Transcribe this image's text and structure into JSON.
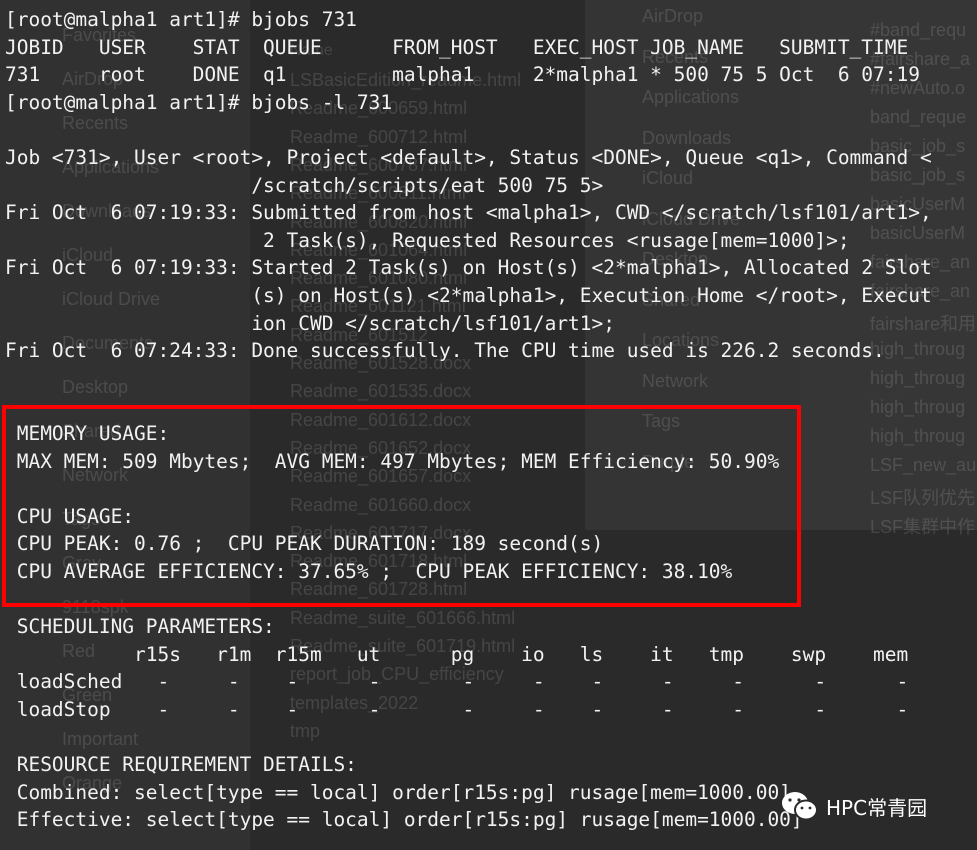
{
  "background_window": {
    "sidebar": [
      "Favorites",
      "AirDrop",
      "Recents",
      "Applications",
      "Downloads",
      "iCloud",
      "iCloud Drive",
      "Documents",
      "Desktop",
      "Shared",
      "Network",
      "Tags",
      "Gray",
      "9118spk",
      "Red",
      "Green",
      "Important",
      "Orange"
    ],
    "column_header": "Name",
    "files": [
      "LSBasicEdition_readme.html",
      "Readme_600659.html",
      "Readme_600712.html",
      "Readme_600787.html",
      "Readme_600811.html",
      "Readme_600820.html",
      "Readme_601064.html",
      "Readme_601080.html",
      "Readme_601121.html",
      "Readme_601512",
      "Readme_601528.docx",
      "Readme_601535.docx",
      "Readme_601612.docx",
      "Readme_601652.docx",
      "Readme_601657.docx",
      "Readme_601660.docx",
      "Readme_601717.docx",
      "Readme_601718.html",
      "Readme_601728.html",
      "Readme_suite_601666.html",
      "Readme_suite_601719.html",
      "report_job_CPU_efficiency",
      "templates_2022",
      "tmp"
    ],
    "popup": [
      "AirDrop",
      "Recents",
      "Applications",
      "Downloads",
      "iCloud",
      "iCloud Drive",
      "Desktop",
      "Shared",
      "Locations",
      "Network",
      "Tags",
      "Purple"
    ],
    "right_files": [
      "#band_requ",
      "#fairshare_a",
      "#newAuto.o",
      "band_reque",
      "basic_job_s",
      "basic_job_s",
      "basicUserM",
      "basicUserM",
      "fairshare_an",
      "fairshare_an",
      "fairshare和用",
      "high_throug",
      "high_throug",
      "high_throug",
      "high_throug",
      "LSF_new_au",
      "LSF队列优先",
      "LSF集群中作"
    ]
  },
  "terminal": {
    "lines": [
      "[root@malpha1 art1]# bjobs 731",
      "JOBID   USER    STAT  QUEUE      FROM_HOST   EXEC_HOST JOB_NAME   SUBMIT_TIME",
      "731     root    DONE  q1         malpha1     2*malpha1 * 500 75 5 Oct  6 07:19",
      "[root@malpha1 art1]# bjobs -l 731",
      "",
      "Job <731>, User <root>, Project <default>, Status <DONE>, Queue <q1>, Command <",
      "                     /scratch/scripts/eat 500 75 5>",
      "Fri Oct  6 07:19:33: Submitted from host <malpha1>, CWD </scratch/lsf101/art1>,",
      "                      2 Task(s), Requested Resources <rusage[mem=1000]>;",
      "Fri Oct  6 07:19:33: Started 2 Task(s) on Host(s) <2*malpha1>, Allocated 2 Slot",
      "                     (s) on Host(s) <2*malpha1>, Execution Home </root>, Execut",
      "                     ion CWD </scratch/lsf101/art1>;",
      "Fri Oct  6 07:24:33: Done successfully. The CPU time used is 226.2 seconds.",
      "",
      "",
      " MEMORY USAGE:",
      " MAX MEM: 509 Mbytes;  AVG MEM: 497 Mbytes; MEM Efficiency: 50.90%",
      "",
      " CPU USAGE:",
      " CPU PEAK: 0.76 ;  CPU PEAK DURATION: 189 second(s)",
      " CPU AVERAGE EFFICIENCY: 37.65% ;  CPU PEAK EFFICIENCY: 38.10%",
      "",
      " SCHEDULING PARAMETERS:",
      "           r15s   r1m  r15m   ut      pg    io   ls    it   tmp    swp    mem",
      " loadSched   -     -    -      -       -     -    -     -     -      -      -",
      " loadStop    -     -    -      -       -     -    -     -     -      -      -",
      "",
      " RESOURCE REQUIREMENT DETAILS:",
      " Combined: select[type == local] order[r15s:pg] rusage[mem=1000.00]",
      " Effective: select[type == local] order[r15s:pg] rusage[mem=1000.00]"
    ]
  },
  "highlight": {
    "color": "#ff0000"
  },
  "watermark": {
    "icon": "wechat-icon",
    "text": "HPC常青园"
  }
}
